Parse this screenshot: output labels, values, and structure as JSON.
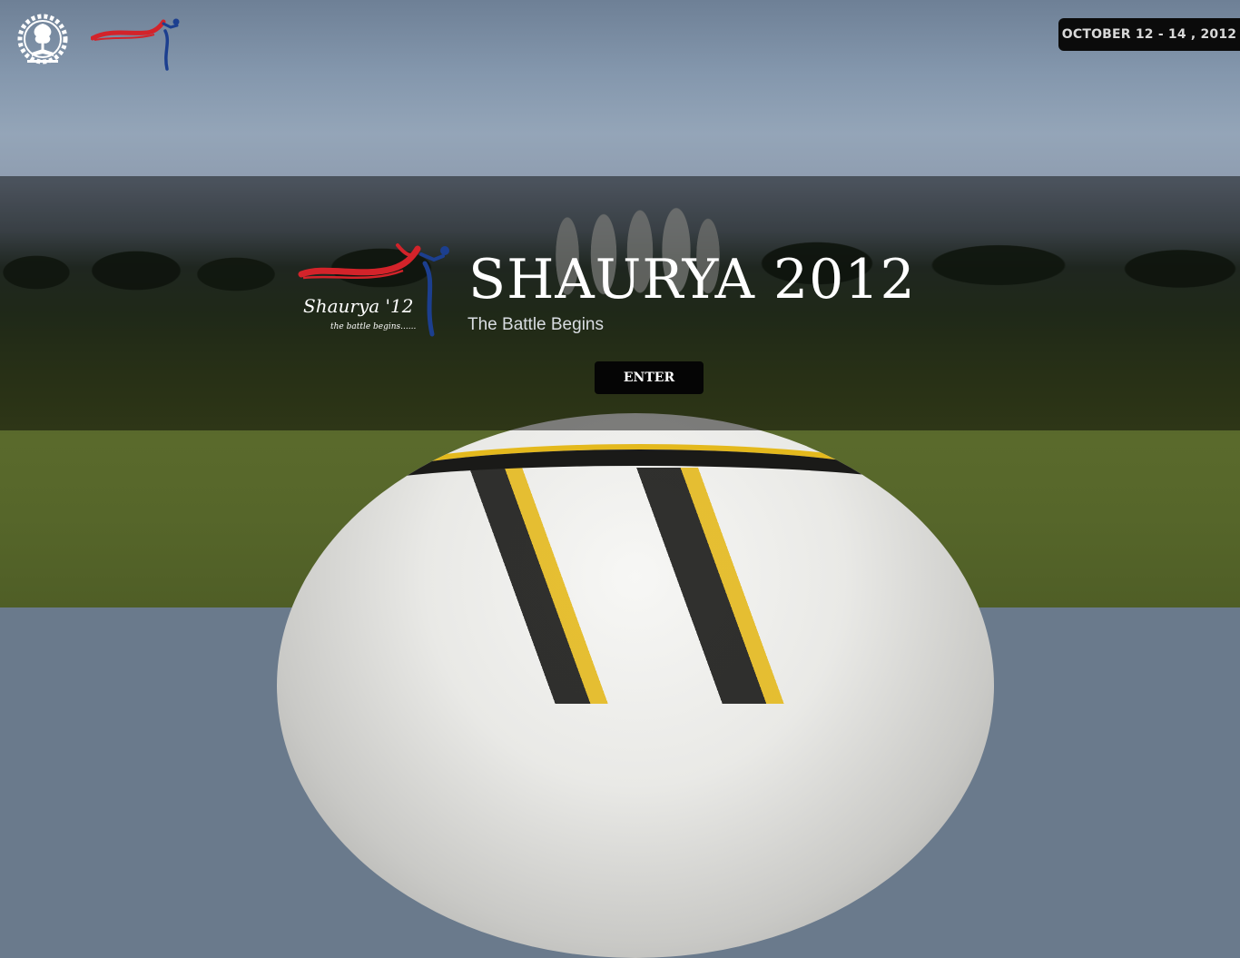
{
  "header": {
    "date_range": "OCTOBER 12 - 14 , 2012",
    "left_logo_icon": "iit-kharagpur-emblem-icon",
    "right_logo_icon": "shaurya-runner-logo-icon"
  },
  "hero": {
    "logo_icon": "shaurya-12-logo-icon",
    "logo_text": "Shaurya '12",
    "logo_tagline": "the battle begins......",
    "title": "SHAURYA 2012",
    "subtitle": "The Battle Begins",
    "enter_label": "ENTER"
  },
  "colors": {
    "logo_red": "#d3232a",
    "logo_blue": "#1c3f8f",
    "button_bg": "#050505",
    "badge_bg": "#0b0b0b"
  }
}
